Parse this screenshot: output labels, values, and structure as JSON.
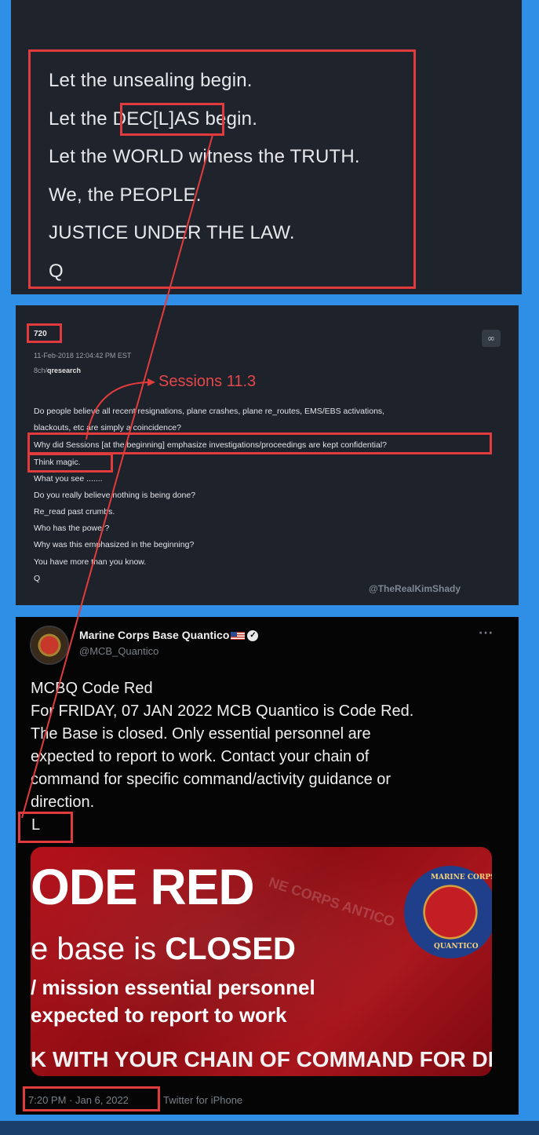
{
  "q_post": {
    "lines": [
      "Let the unsealing begin.",
      "Let the DEC[L]AS begin.",
      "Let the WORLD witness the TRUTH.",
      "We, the PEOPLE.",
      "JUSTICE UNDER THE LAW.",
      "Q"
    ]
  },
  "post_720": {
    "number": "720",
    "timestamp": "11-Feb-2018 12:04:42 PM EST",
    "board_prefix": "8ch/",
    "board": "qresearch",
    "annotation": "Sessions 11.3",
    "lines": [
      "Do people believe all recent resignations, plane crashes, plane re_routes, EMS/EBS activations,",
      "blackouts, etc are simply a coincidence?",
      "Why did Sessions [at the beginning] emphasize investigations/proceedings are kept confidential?",
      "Think magic.",
      "What you see .......",
      "Do you really believe nothing is being done?",
      "Re_read past crumbs.",
      "Who has the power?",
      "Why was this emphasized in the beginning?",
      "You have more than you know.",
      "Q"
    ],
    "watermark": "@TheRealKimShady"
  },
  "tweet": {
    "name": "Marine Corps Base Quantico",
    "handle": "@MCB_Quantico",
    "lines": [
      "MCBQ Code Red",
      "For FRIDAY, 07 JAN 2022 MCB Quantico is Code Red.",
      "The Base is closed.  Only essential personnel are",
      "expected to report to work.  Contact your chain of",
      "command for specific command/activity guidance or",
      "direction."
    ],
    "highlight_letter": "L",
    "banner": {
      "line1": "ODE RED",
      "line2_prefix": "e base is ",
      "line2_bold": "CLOSED",
      "line3": "/ mission essential personnel",
      "line4": "expected to report to work",
      "line5": "K WITH YOUR CHAIN OF COMMAND FOR DE",
      "seal_text_top": "MARINE CORPS",
      "seal_text_bottom": "QUANTICO",
      "bg_text": "NE CORPS  ANTICO"
    },
    "time": "7:20 PM · Jan 6, 2022",
    "client": "Twitter for iPhone"
  },
  "colors": {
    "frame_blue": "#2f8fe6",
    "highlight_red": "#e23b3d",
    "banner_red": "#b4111a"
  }
}
